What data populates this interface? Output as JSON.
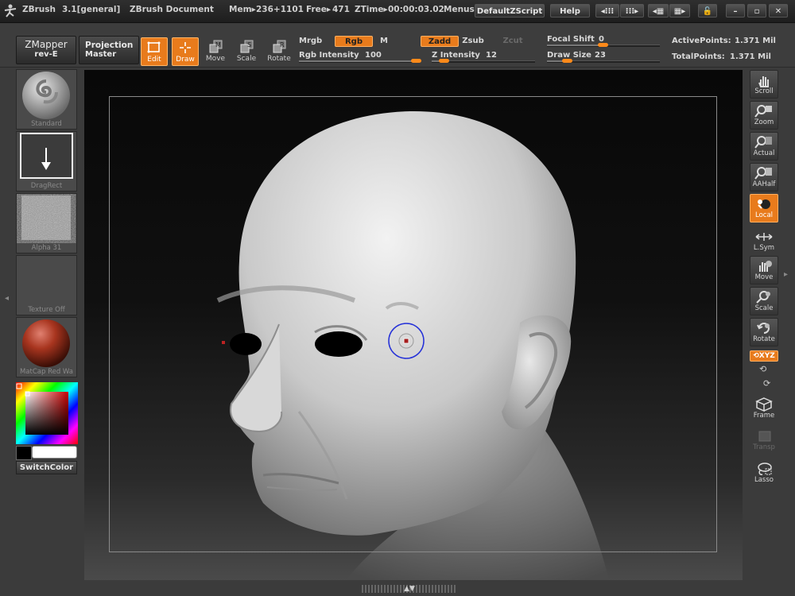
{
  "titlebar": {
    "app": "ZBrush",
    "version": "3.1[general]",
    "doc": "ZBrush Document",
    "mem_label": "Mem▸",
    "mem_value": "236+1101",
    "free_label": "Free▸",
    "free_value": "471",
    "ztime_label": "ZTime▸",
    "ztime_value": "00:00:03.02",
    "menus": "Menus",
    "script": "DefaultZScript",
    "help": "Help"
  },
  "toolbar": {
    "zmapper_title": "ZMapper",
    "zmapper_sub": "rev-E",
    "projection_title": "Projection",
    "projection_sub": "Master",
    "tools": [
      {
        "label": "Edit",
        "icon": "edit-icon"
      },
      {
        "label": "Draw",
        "icon": "draw-icon"
      },
      {
        "label": "Move",
        "icon": "move-icon"
      },
      {
        "label": "Scale",
        "icon": "scale-icon"
      },
      {
        "label": "Rotate",
        "icon": "rotate-icon"
      }
    ],
    "mrgb": "Mrgb",
    "rgb": "Rgb",
    "m": "M",
    "rgb_intensity_label": "Rgb Intensity",
    "rgb_intensity_value": "100",
    "zadd": "Zadd",
    "zsub": "Zsub",
    "zcut": "Zcut",
    "z_intensity_label": "Z Intensity",
    "z_intensity_value": "12",
    "focal_shift_label": "Focal Shift",
    "focal_shift_value": "0",
    "draw_size_label": "Draw Size",
    "draw_size_value": "23",
    "active_points_label": "ActivePoints:",
    "active_points_value": "1.371 Mil",
    "total_points_label": "TotalPoints:",
    "total_points_value": "1.371 Mil",
    "rgb_intensity_fraction": 1.0,
    "z_intensity_fraction": 0.12,
    "focal_shift_fraction": 0.5,
    "draw_size_fraction": 0.18
  },
  "left_shelf": {
    "brush": "Standard",
    "stroke": "DragRect",
    "alpha": "Alpha 31",
    "texture": "Texture Off",
    "material": "MatCap Red Wa",
    "switch_color": "SwitchColor"
  },
  "right_shelf": [
    {
      "label": "Scroll",
      "icon": "scroll-icon"
    },
    {
      "label": "Zoom",
      "icon": "zoom-icon"
    },
    {
      "label": "Actual",
      "icon": "actual-icon"
    },
    {
      "label": "AAHalf",
      "icon": "aahalf-icon"
    },
    {
      "label": "Local",
      "icon": "local-icon"
    },
    {
      "label": "L.Sym",
      "icon": "lsym-icon"
    },
    {
      "label": "Move",
      "icon": "move-icon"
    },
    {
      "label": "Scale",
      "icon": "scale-icon"
    },
    {
      "label": "Rotate",
      "icon": "rotate-icon"
    },
    {
      "label": "XYZ",
      "icon": "xyz-icon"
    },
    {
      "label": "Frame",
      "icon": "frame-icon"
    },
    {
      "label": "Transp",
      "icon": "transp-icon"
    },
    {
      "label": "Lasso",
      "icon": "lasso-icon"
    }
  ],
  "colors": {
    "accent": "#e87b1c",
    "background": "#3b3b3b",
    "canvas": "#0c0c0c",
    "brush_cursor": "#2430d8"
  }
}
